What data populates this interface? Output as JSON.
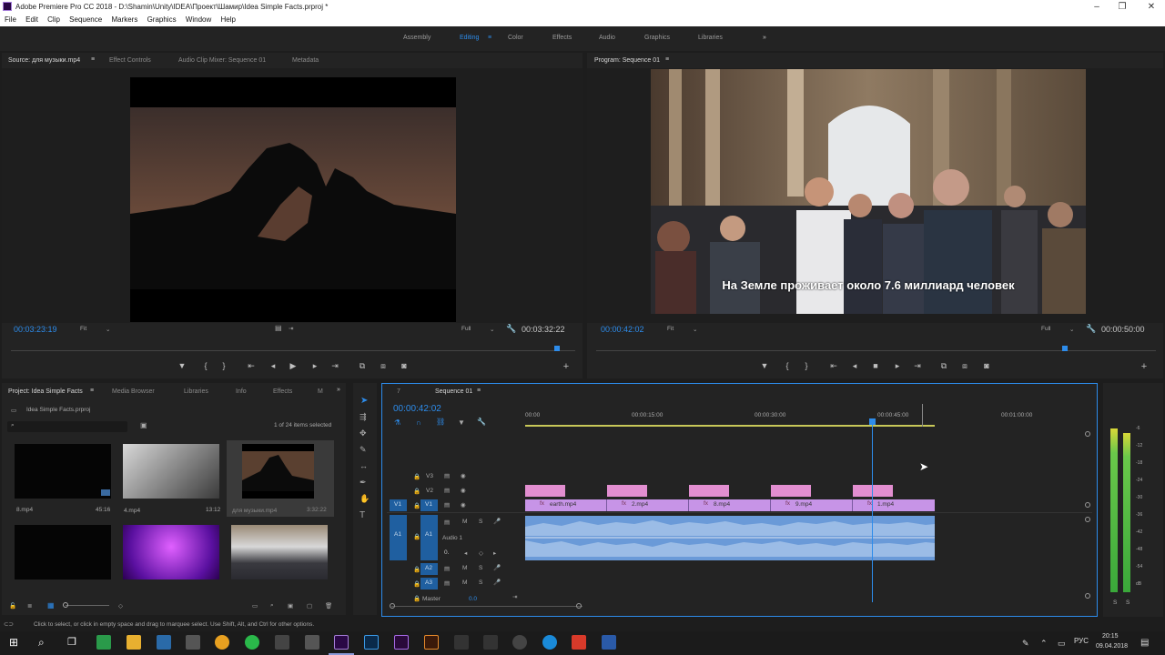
{
  "window": {
    "title": "Adobe Premiere Pro CC 2018 - D:\\Shamin\\Unity\\IDEA\\Проект\\Шамир\\Idea Simple Facts.prproj *"
  },
  "menu": [
    "File",
    "Edit",
    "Clip",
    "Sequence",
    "Markers",
    "Graphics",
    "Window",
    "Help"
  ],
  "workspaces": {
    "items": [
      "Assembly",
      "Editing",
      "Color",
      "Effects",
      "Audio",
      "Graphics",
      "Libraries"
    ],
    "active": "Editing",
    "more": "»"
  },
  "source": {
    "tabs": [
      "Source: для музыки.mp4",
      "Effect Controls",
      "Audio Clip Mixer: Sequence 01",
      "Metadata"
    ],
    "timecode": "00:03:23:19",
    "fit": "Fit",
    "duration": "00:03:32:22",
    "quality": "Full"
  },
  "program": {
    "tab": "Program: Sequence 01",
    "timecode": "00:00:42:02",
    "fit": "Fit",
    "duration": "00:00:50:00",
    "quality": "Full",
    "subtitle": "На Земле проживает около 7.6 миллиард человек"
  },
  "project": {
    "tabs": [
      "Project: Idea Simple Facts",
      "Media Browser",
      "Libraries",
      "Info",
      "Effects",
      "M"
    ],
    "file": "Idea Simple Facts.prproj",
    "selection": "1 of 24 items selected",
    "items": [
      {
        "name": "8.mp4",
        "dur": "45:16"
      },
      {
        "name": "4.mp4",
        "dur": "13:12"
      },
      {
        "name": "для музыки.mp4",
        "dur": "3:32:22"
      },
      {
        "name": "",
        "dur": ""
      },
      {
        "name": "",
        "dur": ""
      },
      {
        "name": "",
        "dur": ""
      }
    ]
  },
  "timeline": {
    "tabs": [
      "7",
      "Sequence 01"
    ],
    "timecode": "00:00:42:02",
    "ruler": [
      "00:00",
      "00:00:15:00",
      "00:00:30:00",
      "00:00:45:00",
      "00:01:00:00"
    ],
    "tracks": {
      "v3": "V3",
      "v2": "V2",
      "v1": "V1",
      "a1": "A1",
      "a2": "A2",
      "a3": "A3",
      "audio1": "Audio 1",
      "master": "Master",
      "master_val": "0.0",
      "src_v1": "V1",
      "src_a1": "A1",
      "vol": "0."
    },
    "clips": [
      "earth.mp4",
      "2.mp4",
      "8.mp4",
      "9.mp4",
      "1.mp4"
    ],
    "fx": [
      "fx",
      "fx",
      "fx",
      "fx",
      "fx"
    ]
  },
  "meter": {
    "labels": [
      "-6",
      "-12",
      "-18",
      "-24",
      "-30",
      "-36",
      "-42",
      "-48",
      "-54",
      "dB"
    ],
    "s1": "S",
    "s2": "S"
  },
  "status": "Click to select, or click in empty space and drag to marquee select. Use Shift, Alt, and Ctrl for other options.",
  "taskbar": {
    "time": "20:15",
    "date": "09.04.2018",
    "lang": "РУС"
  },
  "colors": {
    "accent": "#2d8ceb",
    "video_clip": "#e28ed0",
    "video_clip_dark": "#c794e7",
    "audio_clip": "#6a9ad8"
  }
}
